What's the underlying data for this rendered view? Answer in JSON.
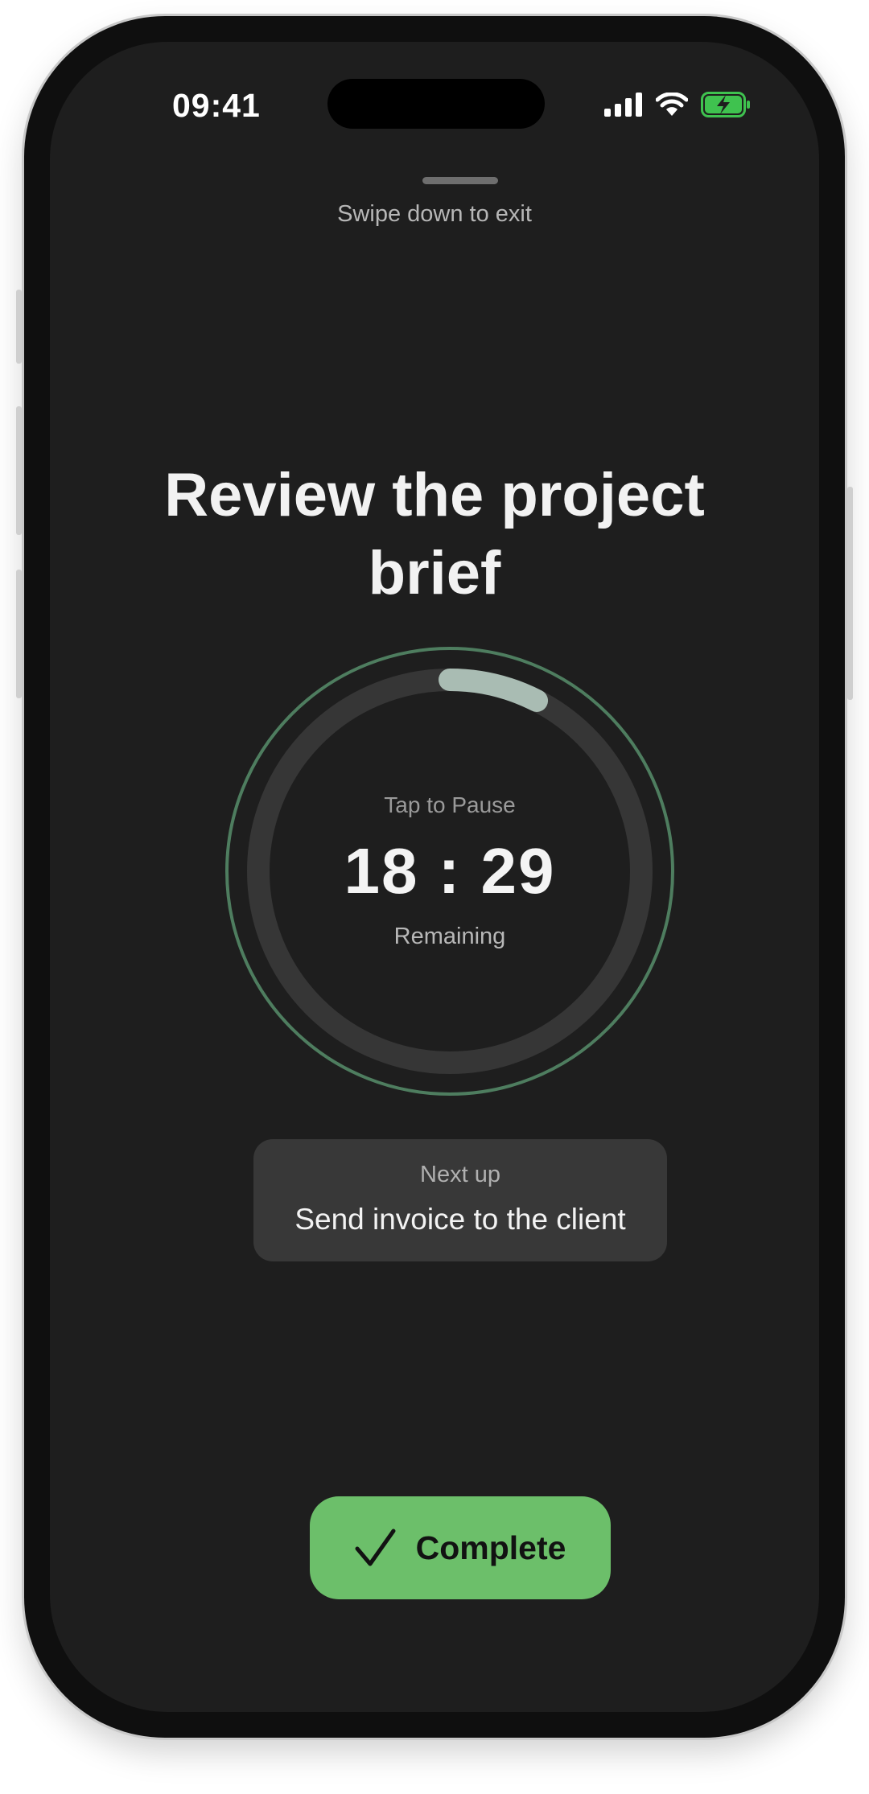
{
  "status_bar": {
    "time": "09:41",
    "icons": [
      "signal-icon",
      "wifi-icon",
      "battery-charging-icon"
    ],
    "battery_color": "#3fc24f"
  },
  "sheet": {
    "swipe_hint": "Swipe down to exit"
  },
  "task": {
    "title": "Review the project brief"
  },
  "timer": {
    "pause_label": "Tap to Pause",
    "time_remaining": "18 : 29",
    "remaining_label": "Remaining",
    "progress_fraction": 0.075,
    "progress_color": "#a9bcb3",
    "outer_ring_color": "#4e7d5f"
  },
  "next_up": {
    "label": "Next up",
    "task": "Send invoice to the client"
  },
  "complete_button": {
    "label": "Complete",
    "icon": "checkmark-icon",
    "color": "#6cbf6a"
  }
}
